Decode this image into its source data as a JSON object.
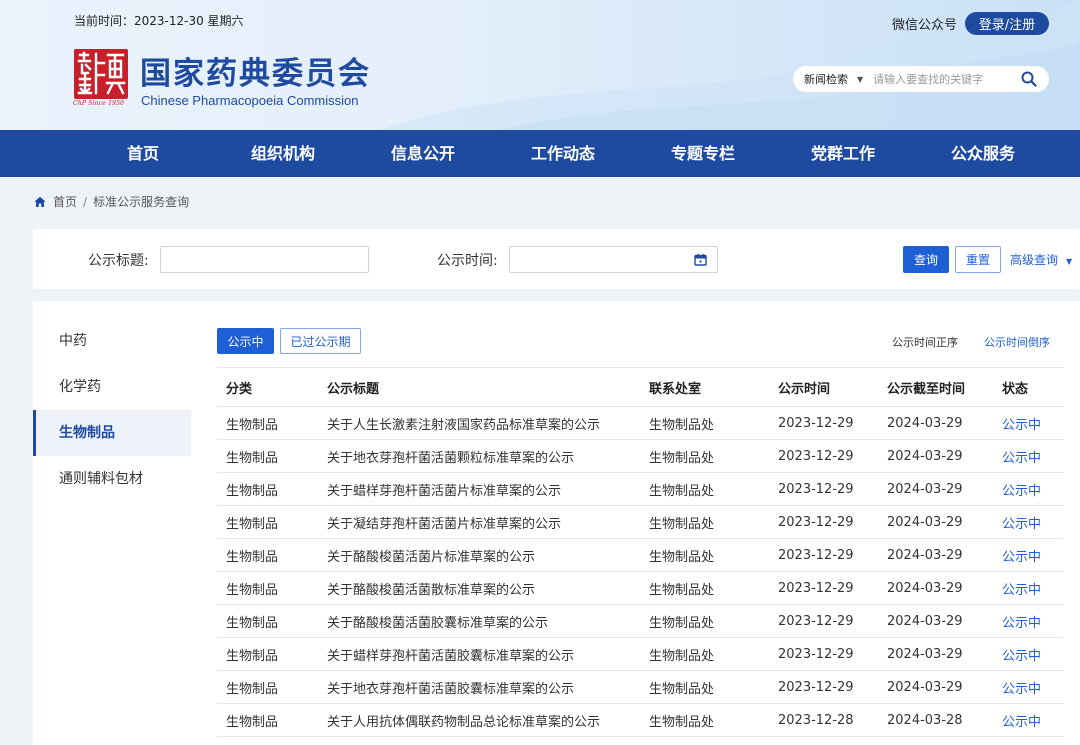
{
  "header": {
    "date_line": "当前时间：2023-12-30 星期六",
    "seal_caption": "ChP Since 1950",
    "title": "国家药典委员会",
    "subtitle": "Chinese Pharmacopoeia Commission",
    "wechat": "微信公众号",
    "login": "登录/注册",
    "search": {
      "category": "新闻检索",
      "placeholder": "请输入要查找的关键字",
      "icon": "search-icon"
    }
  },
  "nav": {
    "items": [
      {
        "label": "首页"
      },
      {
        "label": "组织机构"
      },
      {
        "label": "信息公开"
      },
      {
        "label": "工作动态"
      },
      {
        "label": "专题专栏"
      },
      {
        "label": "党群工作"
      },
      {
        "label": "公众服务"
      }
    ]
  },
  "breadcrumb": {
    "home": "首页",
    "separator": "/",
    "current": "标准公示服务查询"
  },
  "filter": {
    "title_label": "公示标题:",
    "title_value": "",
    "time_label": "公示时间:",
    "time_value": "",
    "query_button": "查询",
    "reset_button": "重置",
    "advanced": "高级查询"
  },
  "sidebar": {
    "items": [
      {
        "label": "中药"
      },
      {
        "label": "化学药"
      },
      {
        "label": "生物制品"
      },
      {
        "label": "通则辅料包材"
      }
    ],
    "active": "生物制品"
  },
  "main": {
    "tabs": [
      {
        "label": "公示中"
      },
      {
        "label": "已过公示期"
      }
    ],
    "sort_asc": "公示时间正序",
    "sort_desc": "公示时间倒序",
    "table": {
      "headers": [
        "分类",
        "公示标题",
        "联系处室",
        "公示时间",
        "公示截至时间",
        "状态"
      ],
      "rows": [
        [
          "生物制品",
          "关于人生长激素注射液国家药品标准草案的公示",
          "生物制品处",
          "2023-12-29",
          "2024-03-29",
          "公示中"
        ],
        [
          "生物制品",
          "关于地衣芽孢杆菌活菌颗粒标准草案的公示",
          "生物制品处",
          "2023-12-29",
          "2024-03-29",
          "公示中"
        ],
        [
          "生物制品",
          "关于蜡样芽孢杆菌活菌片标准草案的公示",
          "生物制品处",
          "2023-12-29",
          "2024-03-29",
          "公示中"
        ],
        [
          "生物制品",
          "关于凝结芽孢杆菌活菌片标准草案的公示",
          "生物制品处",
          "2023-12-29",
          "2024-03-29",
          "公示中"
        ],
        [
          "生物制品",
          "关于酪酸梭菌活菌片标准草案的公示",
          "生物制品处",
          "2023-12-29",
          "2024-03-29",
          "公示中"
        ],
        [
          "生物制品",
          "关于酪酸梭菌活菌散标准草案的公示",
          "生物制品处",
          "2023-12-29",
          "2024-03-29",
          "公示中"
        ],
        [
          "生物制品",
          "关于酪酸梭菌活菌胶囊标准草案的公示",
          "生物制品处",
          "2023-12-29",
          "2024-03-29",
          "公示中"
        ],
        [
          "生物制品",
          "关于蜡样芽孢杆菌活菌胶囊标准草案的公示",
          "生物制品处",
          "2023-12-29",
          "2024-03-29",
          "公示中"
        ],
        [
          "生物制品",
          "关于地衣芽孢杆菌活菌胶囊标准草案的公示",
          "生物制品处",
          "2023-12-29",
          "2024-03-29",
          "公示中"
        ],
        [
          "生物制品",
          "关于人用抗体偶联药物制品总论标准草案的公示",
          "生物制品处",
          "2023-12-28",
          "2024-03-28",
          "公示中"
        ]
      ]
    }
  },
  "colors": {
    "brand_blue": "#1e4aa0",
    "link_blue": "#1e5fd6",
    "seal_red": "#c8202a"
  }
}
